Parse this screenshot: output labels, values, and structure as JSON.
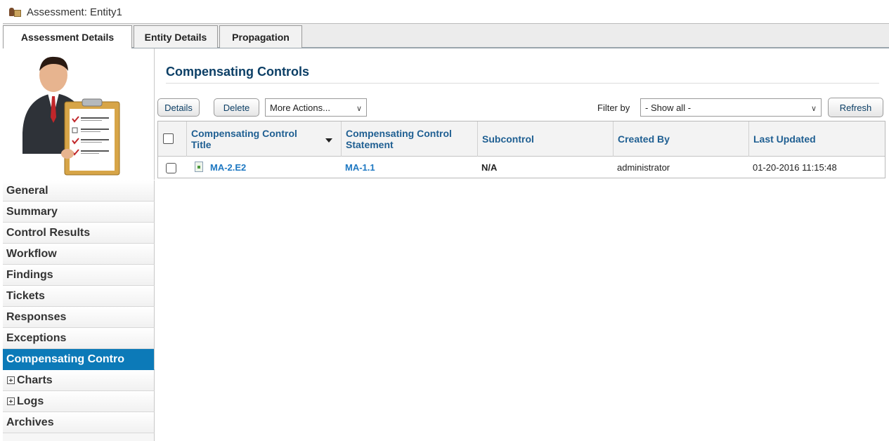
{
  "window": {
    "title": "Assessment: Entity1",
    "icon": "assessment-icon"
  },
  "tabs": [
    {
      "label": "Assessment Details",
      "active": true
    },
    {
      "label": "Entity Details",
      "active": false
    },
    {
      "label": "Propagation",
      "active": false
    }
  ],
  "sidebar": {
    "avatar_icon": "assessor-checklist-icon",
    "items": [
      {
        "label": "General"
      },
      {
        "label": "Summary"
      },
      {
        "label": "Control Results"
      },
      {
        "label": "Workflow"
      },
      {
        "label": "Findings"
      },
      {
        "label": "Tickets"
      },
      {
        "label": "Responses"
      },
      {
        "label": "Exceptions"
      },
      {
        "label": "Compensating Contro",
        "active": true
      },
      {
        "label": "Charts",
        "expandable": true
      },
      {
        "label": "Logs",
        "expandable": true
      },
      {
        "label": "Archives"
      }
    ]
  },
  "main": {
    "title": "Compensating Controls",
    "toolbar": {
      "details_label": "Details",
      "delete_label": "Delete",
      "more_actions_value": "More Actions...",
      "filter_label": "Filter by",
      "filter_value": "- Show all -",
      "refresh_label": "Refresh"
    },
    "table": {
      "columns": {
        "title": [
          "Compensating Control",
          "Title"
        ],
        "statement": [
          "Compensating Control",
          "Statement"
        ],
        "subcontrol": "Subcontrol",
        "created_by": "Created By",
        "last_updated": "Last Updated"
      },
      "rows": [
        {
          "title": "MA-2.E2",
          "statement": "MA-1.1",
          "subcontrol": "N/A",
          "created_by": "administrator",
          "last_updated": "01-20-2016 11:15:48"
        }
      ]
    }
  },
  "colors": {
    "accent": "#0c7ab8",
    "link": "#1e78c2",
    "heading": "#0c3f66"
  }
}
